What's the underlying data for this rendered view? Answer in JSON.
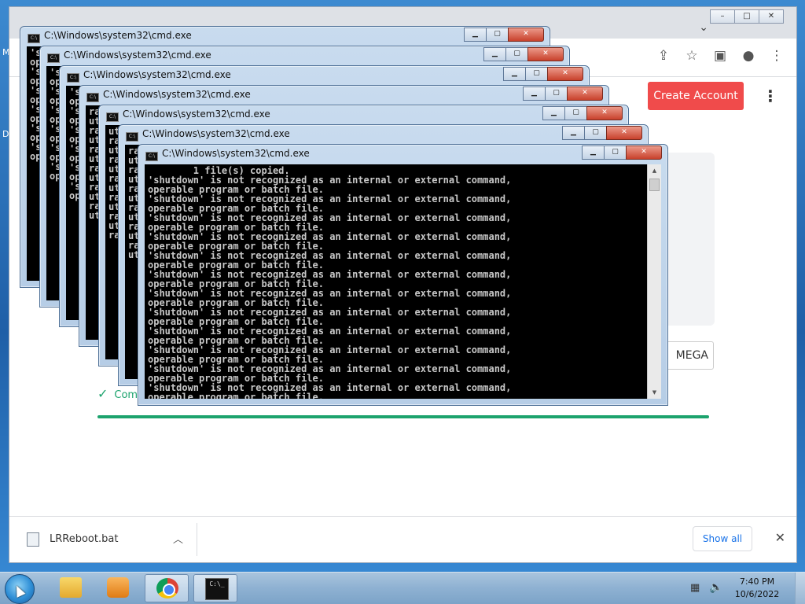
{
  "desktop": {
    "left_glyphs": [
      "M",
      "D"
    ]
  },
  "browser": {
    "window_controls": [
      "–",
      "□",
      "✕"
    ],
    "tab_dropdown": "⌄",
    "omnibar_icons": [
      "share-icon",
      "star-icon",
      "sidebar-icon",
      "profile-icon",
      "menu-icon"
    ],
    "page": {
      "create_account_label": "Create Account",
      "mega_button_label": "MEGA",
      "completed_text": "Com",
      "accent_color": "#f04b4b",
      "success_color": "#1ca36d"
    },
    "download_shelf": {
      "filename": "LRReboot.bat",
      "show_all_label": "Show all"
    }
  },
  "cmd_windows": [
    {
      "title": "C:\\Windows\\system32\\cmd.exe",
      "lines": [
        "'s",
        "op",
        "'s",
        "op",
        "'s",
        "op",
        "'s",
        "op",
        "'s",
        "op",
        "'s",
        "op"
      ]
    },
    {
      "title": "C:\\Windows\\system32\\cmd.exe",
      "lines": [
        "'s",
        "op",
        "'s",
        "op",
        "'s",
        "op",
        "'s",
        "op",
        "'s",
        "op",
        "'s",
        "op"
      ]
    },
    {
      "title": "C:\\Windows\\system32\\cmd.exe",
      "lines": [
        "'s",
        "op",
        "'s",
        "op",
        "'s",
        "op",
        "'s",
        "op",
        "'s",
        "op",
        "'s",
        "op"
      ]
    },
    {
      "title": "C:\\Windows\\system32\\cmd.exe",
      "lines": [
        "ra",
        "ut",
        "ra",
        "ut",
        "ra",
        "ut",
        "ra",
        "ut",
        "ra",
        "ut",
        "ra",
        "ut"
      ]
    },
    {
      "title": "C:\\Windows\\system32\\cmd.exe",
      "lines": [
        "ut",
        "ra",
        "ut",
        "ra",
        "ut",
        "ra",
        "ut",
        "ra",
        "ut",
        "ra",
        "ut",
        "ra"
      ]
    },
    {
      "title": "C:\\Windows\\system32\\cmd.exe",
      "lines": [
        "ra",
        "ut",
        "ra",
        "ut",
        "ra",
        "ut",
        "ra",
        "ut",
        "ra",
        "ut",
        "ra",
        "ut"
      ]
    },
    {
      "title": "C:\\Windows\\system32\\cmd.exe",
      "lines": [
        "        1 file(s) copied.",
        "'shutdown' is not recognized as an internal or external command,",
        "operable program or batch file.",
        "'shutdown' is not recognized as an internal or external command,",
        "operable program or batch file.",
        "'shutdown' is not recognized as an internal or external command,",
        "operable program or batch file.",
        "'shutdown' is not recognized as an internal or external command,",
        "operable program or batch file.",
        "'shutdown' is not recognized as an internal or external command,",
        "operable program or batch file.",
        "'shutdown' is not recognized as an internal or external command,",
        "operable program or batch file.",
        "'shutdown' is not recognized as an internal or external command,",
        "operable program or batch file.",
        "'shutdown' is not recognized as an internal or external command,",
        "operable program or batch file.",
        "'shutdown' is not recognized as an internal or external command,",
        "operable program or batch file.",
        "'shutdown' is not recognized as an internal or external command,",
        "operable program or batch file.",
        "'shutdown' is not recognized as an internal or external command,",
        "operable program or batch file.",
        "'shutdown' is not recognized as an internal or external command,",
        "operable program or batch file."
      ]
    }
  ],
  "taskbar": {
    "apps": [
      "start-orb",
      "file-explorer",
      "media-player",
      "chrome",
      "command-prompt"
    ],
    "terminal_glyph": "C:\\_",
    "time": "7:40 PM",
    "date": "10/6/2022"
  }
}
